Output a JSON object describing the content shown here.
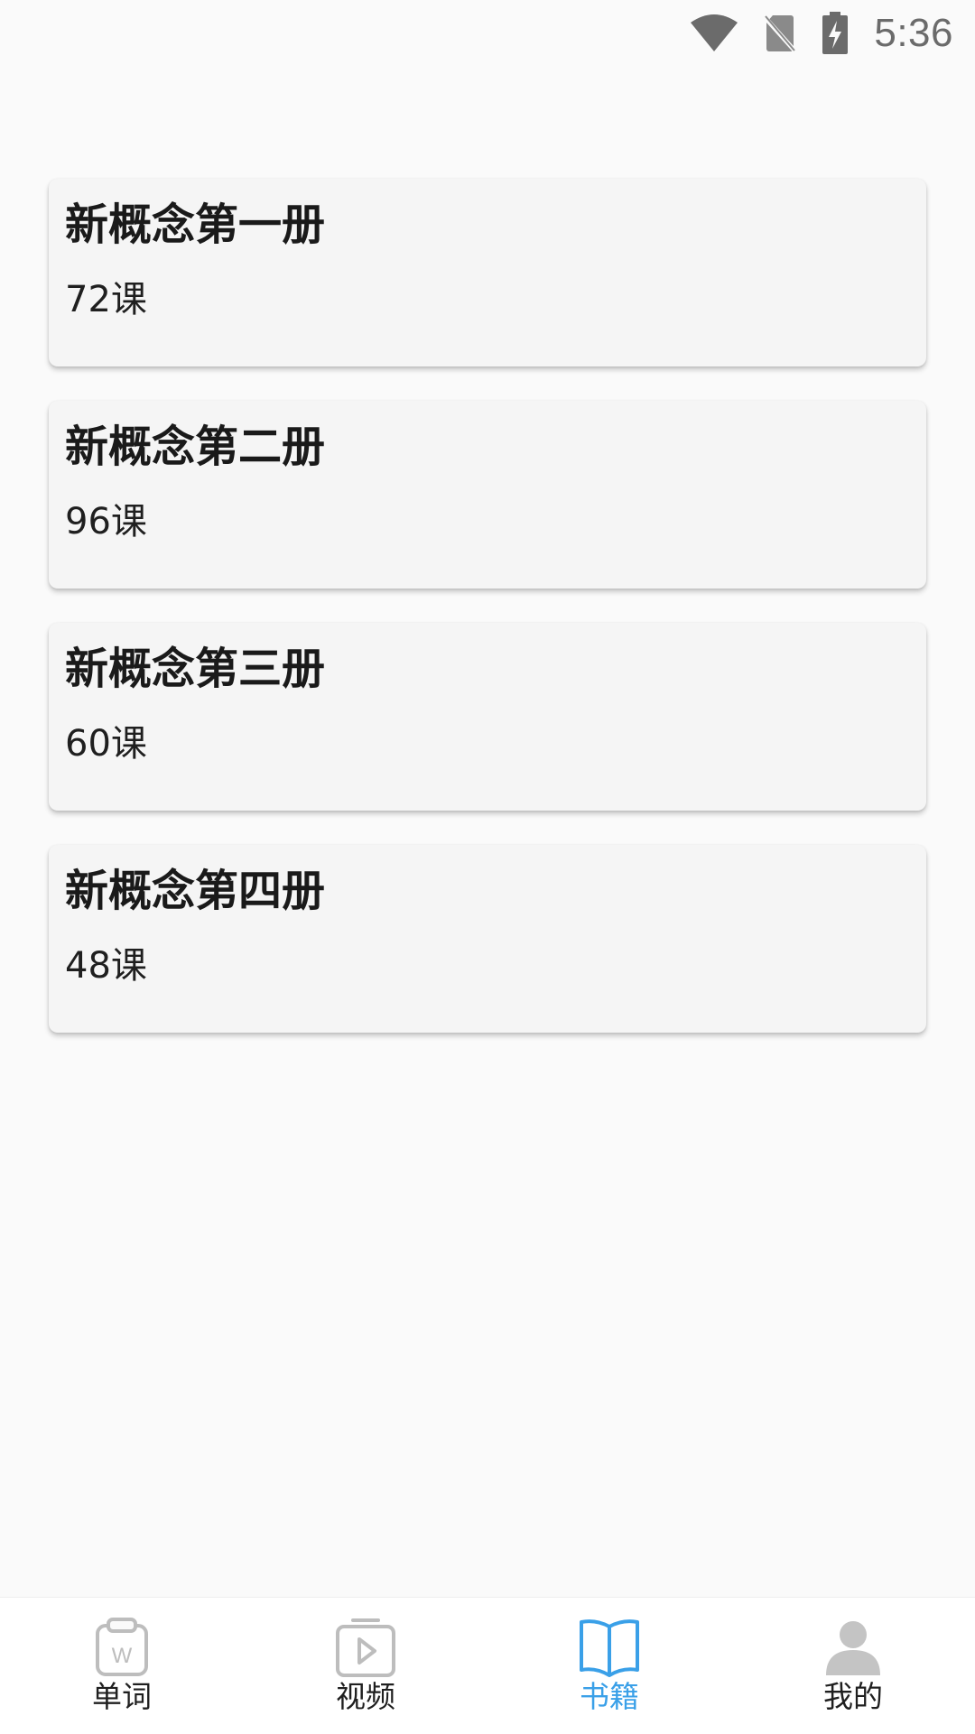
{
  "status_bar": {
    "time": "5:36",
    "icons": [
      "wifi-icon",
      "no-sim-icon",
      "battery-charging-icon"
    ]
  },
  "books": [
    {
      "title": "新概念第一册",
      "lessons": "72课"
    },
    {
      "title": "新概念第二册",
      "lessons": "96课"
    },
    {
      "title": "新概念第三册",
      "lessons": "60课"
    },
    {
      "title": "新概念第四册",
      "lessons": "48课"
    }
  ],
  "bottom_nav": {
    "items": [
      {
        "label": "单词",
        "icon": "word-card-icon",
        "active": false
      },
      {
        "label": "视频",
        "icon": "video-play-icon",
        "active": false
      },
      {
        "label": "书籍",
        "icon": "open-book-icon",
        "active": true
      },
      {
        "label": "我的",
        "icon": "person-icon",
        "active": false
      }
    ],
    "active_color": "#3aa0e8",
    "inactive_icon_color": "#bdbdbd"
  }
}
